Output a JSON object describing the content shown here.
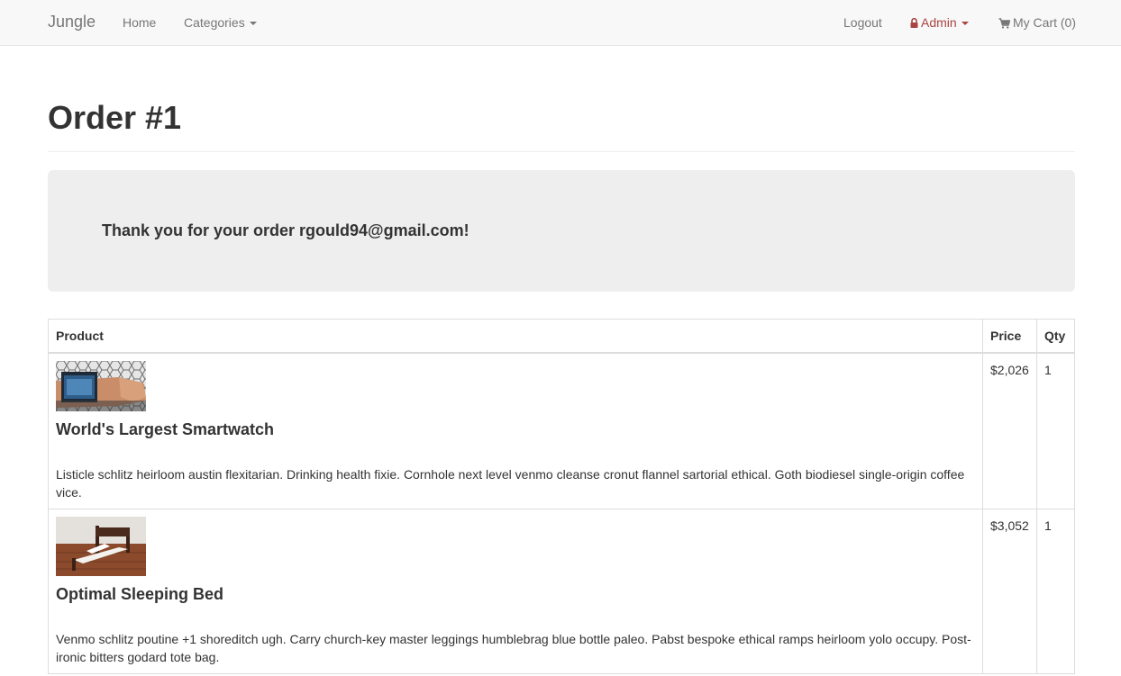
{
  "navbar": {
    "brand": "Jungle",
    "home": "Home",
    "categories": "Categories",
    "logout": "Logout",
    "admin": "Admin",
    "cart": "My Cart (0)"
  },
  "page": {
    "title": "Order #1",
    "thanks": "Thank you for your order rgould94@gmail.com!"
  },
  "table": {
    "headers": [
      "Product",
      "Price",
      "Qty"
    ],
    "rows": [
      {
        "image": "smartwatch-image",
        "name": "World's Largest Smartwatch",
        "description": "Listicle schlitz heirloom austin flexitarian. Drinking health fixie. Cornhole next level venmo cleanse cronut flannel sartorial ethical. Goth biodiesel single-origin coffee vice.",
        "price": "$2,026",
        "qty": "1"
      },
      {
        "image": "bed-image",
        "name": "Optimal Sleeping Bed",
        "description": "Venmo schlitz poutine +1 shoreditch ugh. Carry church-key master leggings humblebrag blue bottle paleo. Pabst bespoke ethical ramps heirloom yolo occupy. Post-ironic bitters godard tote bag.",
        "price": "$3,052",
        "qty": "1"
      }
    ]
  },
  "colors": {
    "navbar_bg": "#f8f8f8",
    "admin": "#a94442",
    "jumbotron_bg": "#eeeeee"
  }
}
